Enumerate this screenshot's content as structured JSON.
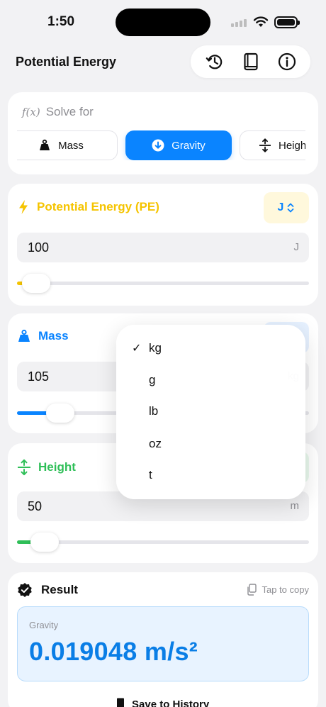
{
  "status": {
    "time": "1:50"
  },
  "nav": {
    "title": "Potential Energy"
  },
  "solve": {
    "title": "Solve for",
    "fx": "f(x)",
    "options": [
      {
        "label": "Mass",
        "selected": false
      },
      {
        "label": "Gravity",
        "selected": true
      },
      {
        "label": "Heigh",
        "selected": false
      }
    ]
  },
  "pe": {
    "label": "Potential Energy (PE)",
    "unit_chip": "J",
    "value": "100",
    "unit": "J",
    "slider_fraction": 0.02,
    "color": "#f5c400"
  },
  "mass": {
    "label": "Mass",
    "value": "105",
    "unit": "kg",
    "slider_fraction": 0.11,
    "color": "#0a84ff"
  },
  "height": {
    "label": "Height",
    "value": "50",
    "unit": "m",
    "slider_fraction": 0.05,
    "color": "#2fbf58"
  },
  "result": {
    "title": "Result",
    "copy_label": "Tap to copy",
    "variable": "Gravity",
    "value": "0.019048 m/s²",
    "save_label": "Save to History"
  },
  "unit_menu": {
    "items": [
      {
        "label": "kg",
        "checked": true
      },
      {
        "label": "g",
        "checked": false
      },
      {
        "label": "lb",
        "checked": false
      },
      {
        "label": "oz",
        "checked": false
      },
      {
        "label": "t",
        "checked": false
      }
    ]
  }
}
